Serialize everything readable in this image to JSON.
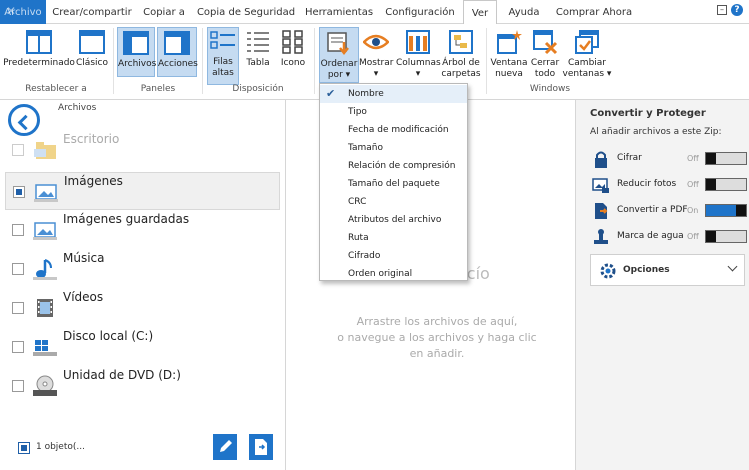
{
  "menu": {
    "tabs": [
      "Archivo",
      "Crear/compartir",
      "Copiar a",
      "Copia de Seguridad",
      "Herramientas",
      "Configuración",
      "Ver",
      "Ayuda",
      "Comprar Ahora"
    ],
    "active_tab": "Ver"
  },
  "ribbon": {
    "buttons": {
      "predeterminado": "Predeterminado",
      "clasico": "Clásico",
      "archivos": "Archivos",
      "acciones": "Acciones",
      "filas_altas_1": "Filas",
      "filas_altas_2": "altas",
      "tabla": "Tabla",
      "icono": "Icono",
      "ordenar_1": "Ordenar",
      "ordenar_2": "por",
      "mostrar": "Mostrar",
      "columnas": "Columnas",
      "arbol_1": "Árbol de",
      "arbol_2": "carpetas",
      "ventana_1": "Ventana",
      "ventana_2": "nueva",
      "cerrar_1": "Cerrar",
      "cerrar_2": "todo",
      "cambiar_1": "Cambiar",
      "cambiar_2": "ventanas"
    },
    "groups": {
      "restablecer": "Restablecer a",
      "paneles": "Paneles",
      "disposicion": "Disposición",
      "windows": "Windows"
    }
  },
  "sort_menu": {
    "items": [
      "Nombre",
      "Tipo",
      "Fecha de modificación",
      "Tamaño",
      "Relación de compresión",
      "Tamaño del paquete",
      "CRC",
      "Atributos del archivo",
      "Ruta",
      "Cifrado",
      "Orden original"
    ],
    "checked": "Nombre"
  },
  "left_pane": {
    "path": "Archivos",
    "locations": [
      "Escritorio",
      "Imágenes",
      "Imágenes guardadas",
      "Música",
      "Vídeos",
      "Disco local (C:)",
      "Unidad de DVD (D:)"
    ],
    "selected": "Imágenes",
    "status": "1 objeto(..."
  },
  "center": {
    "empty_title": "acío",
    "empty_hint_1": "Arrastre los archivos de aquí,",
    "empty_hint_2": "o navegue a los archivos y haga clic",
    "empty_hint_3": "en añadir."
  },
  "right_pane": {
    "title": "Convertir y Proteger",
    "subtitle": "Al añadir archivos a este Zip:",
    "options": [
      {
        "label": "Cifrar",
        "state": "Off",
        "on": false,
        "icon": "lock-icon"
      },
      {
        "label": "Reducir fotos",
        "state": "Off",
        "on": false,
        "icon": "photo-icon"
      },
      {
        "label": "Convertir a PDF",
        "state": "On",
        "on": true,
        "icon": "pdf-icon"
      },
      {
        "label": "Marca de agua",
        "state": "Off",
        "on": false,
        "icon": "stamp-icon"
      }
    ],
    "options_button": "Opciones"
  },
  "colors": {
    "accent": "#1f74c9",
    "selected_bg": "#c5dbf1"
  }
}
